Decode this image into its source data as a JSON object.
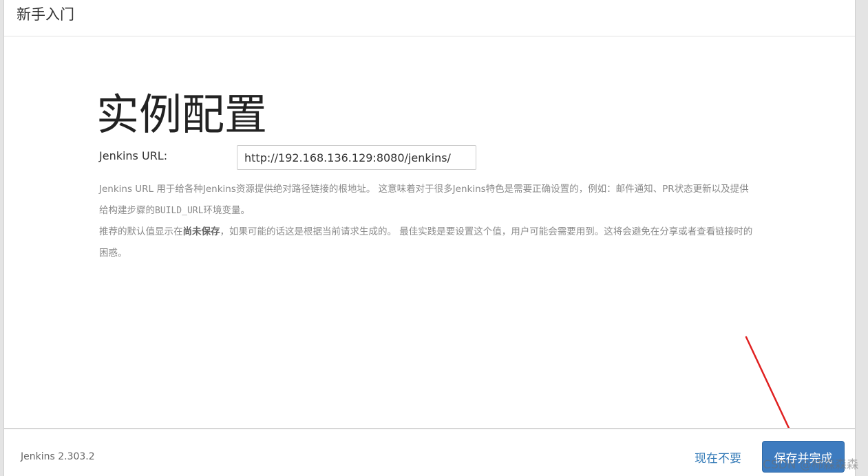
{
  "header": {
    "title": "新手入门"
  },
  "main": {
    "title": "实例配置",
    "url_label": "Jenkins URL:",
    "url_value": "http://192.168.136.129:8080/jenkins/",
    "help_1_a": "Jenkins URL 用于给各种Jenkins资源提供绝对路径链接的根地址。 这意味着对于很多Jenkins特色是需要正确设置的，例如：邮件通知、PR状态更新以及提供给构建步骤的",
    "help_1_code": "BUILD_URL",
    "help_1_b": "环境变量。",
    "help_2_a": "推荐的默认值显示在",
    "help_2_bold": "尚未保存",
    "help_2_b": "，如果可能的话这是根据当前请求生成的。 最佳实践是要设置这个值，用户可能会需要用到。这将会避免在分享或者查看链接时的困惑。"
  },
  "footer": {
    "version": "Jenkins 2.303.2",
    "skip_label": "现在不要",
    "save_label": "保存并完成"
  },
  "annotation": {
    "arrow_color": "#e02020"
  },
  "watermark": "CSDN @柿森森森"
}
